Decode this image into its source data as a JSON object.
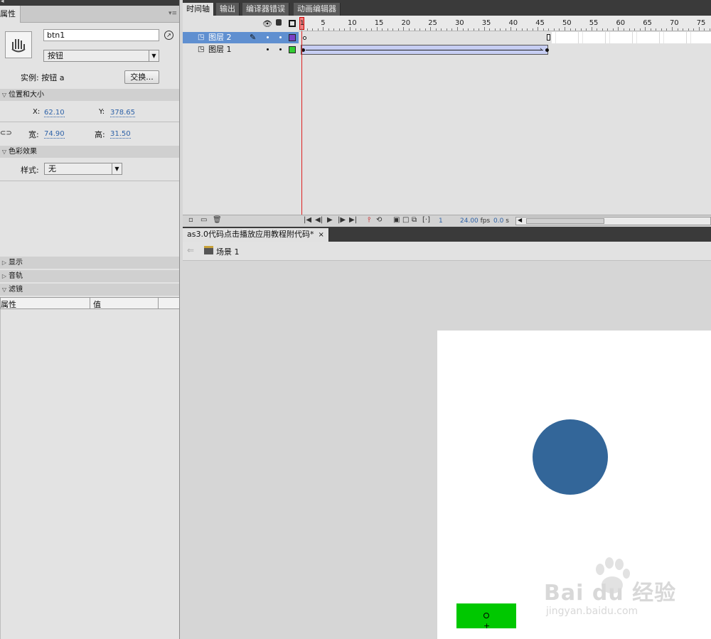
{
  "properties_panel": {
    "tab_label": "属性",
    "instance_name": "btn1",
    "symbol_type": "按钮",
    "instance_of_label": "实例:",
    "instance_of_value": "按钮 a",
    "swap_button": "交换...",
    "section_position_size": "位置和大小",
    "x_label": "X:",
    "x_value": "62.10",
    "y_label": "Y:",
    "y_value": "378.65",
    "width_label": "宽:",
    "width_value": "74.90",
    "height_label": "高:",
    "height_value": "31.50",
    "section_color_effect": "色彩效果",
    "style_label": "样式:",
    "style_value": "无",
    "section_display": "显示",
    "section_tracking": "音轨",
    "section_filters": "滤镜",
    "filters_col_property": "属性",
    "filters_col_value": "值"
  },
  "timeline": {
    "tabs": [
      "时间轴",
      "输出",
      "编译器错误",
      "动画编辑器"
    ],
    "active_tab": "时间轴",
    "frame_ruler": [
      "1",
      "5",
      "10",
      "15",
      "20",
      "25",
      "30",
      "35",
      "40",
      "45",
      "50",
      "55",
      "60",
      "65",
      "70",
      "75"
    ],
    "layers": [
      {
        "name": "图层 2",
        "selected": true,
        "color": "#7a3fc6"
      },
      {
        "name": "图层 1",
        "selected": false,
        "color": "#33cc33"
      }
    ],
    "last_frame": 46,
    "current_frame": "1",
    "fps": "24.00",
    "fps_unit": "fps",
    "elapsed": "0.0",
    "elapsed_unit": "s"
  },
  "document": {
    "tab_title": "as3.0代码点击播放应用教程附代码*",
    "tab_close": "×",
    "scene_label": "场景 1"
  },
  "stage": {
    "background": "#ffffff",
    "circle_color": "#336699",
    "button_color": "#00c800"
  },
  "watermark": {
    "logo_text": "Bai du 经验",
    "url_text": "jingyan.baidu.com"
  }
}
